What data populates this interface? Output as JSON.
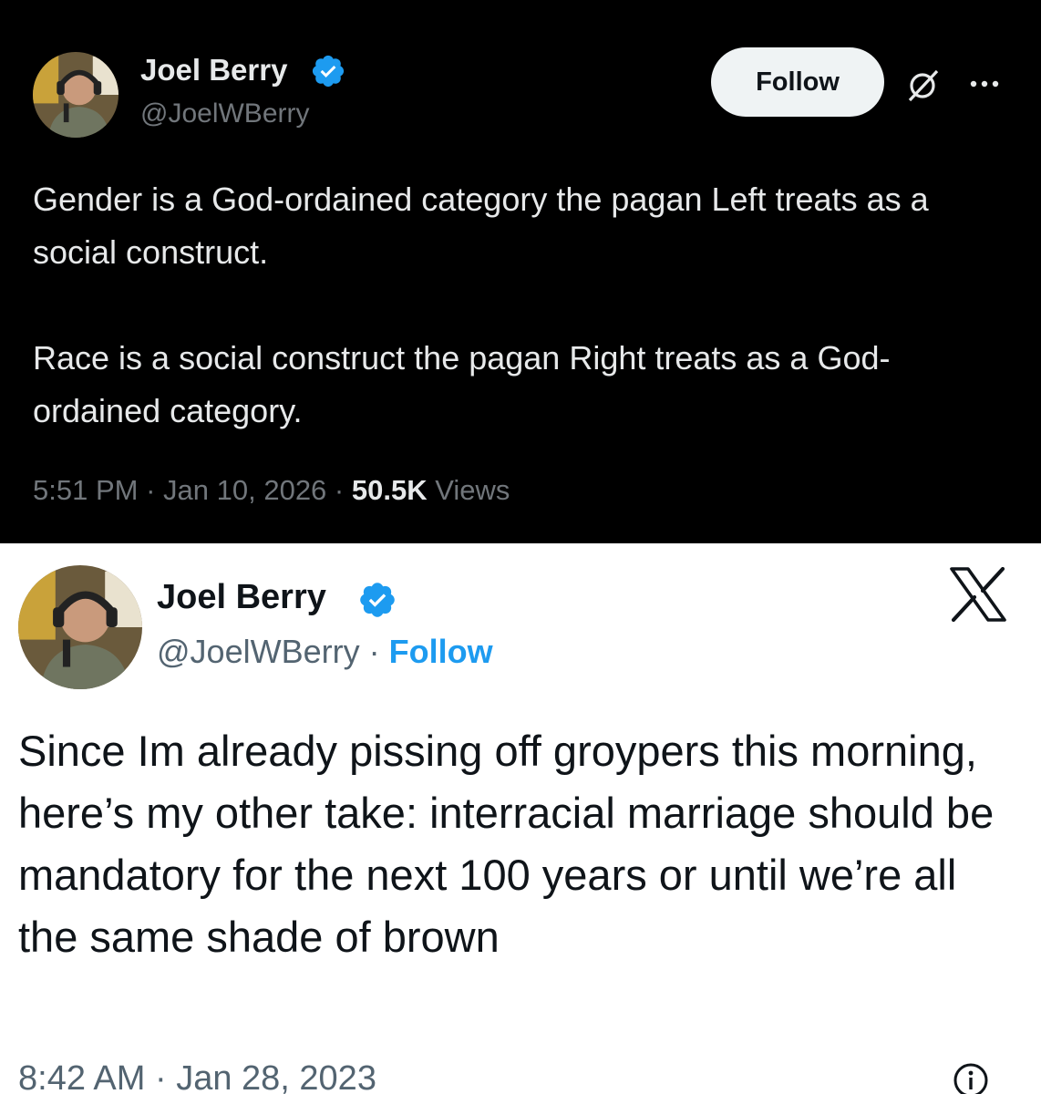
{
  "tweet_top": {
    "author_name": "Joel Berry",
    "author_handle": "@JoelWBerry",
    "follow_label": "Follow",
    "text": "Gender is a God-ordained category the pagan Left treats as a social construct.\n\nRace is a social construct the pagan Right treats as a God-ordained category.",
    "time": "5:51 PM",
    "date": "Jan 10, 2026",
    "views_count": "50.5K",
    "views_label": "Views",
    "separator": "·",
    "icons": [
      "avatar",
      "verified-badge-icon",
      "grok-icon",
      "more-icon"
    ],
    "theme": {
      "background": "#000000",
      "text": "#e7e9ea",
      "muted": "#71767b"
    }
  },
  "tweet_bottom": {
    "author_name": "Joel Berry",
    "author_handle": "@JoelWBerry",
    "follow_label": "Follow",
    "separator": "·",
    "text": "Since Im already pissing off groypers this morning, here’s my other take: interracial marriage should be mandatory for the next 100 years or until we’re all the same shade of brown",
    "time": "8:42 AM",
    "date": "Jan 28, 2023",
    "icons": [
      "avatar",
      "verified-badge-icon",
      "x-logo-icon",
      "info-icon"
    ],
    "theme": {
      "background": "#ffffff",
      "text": "#0f1419",
      "muted": "#536471",
      "link": "#1d9bf0"
    }
  },
  "colors": {
    "verified": "#1d9bf0"
  }
}
